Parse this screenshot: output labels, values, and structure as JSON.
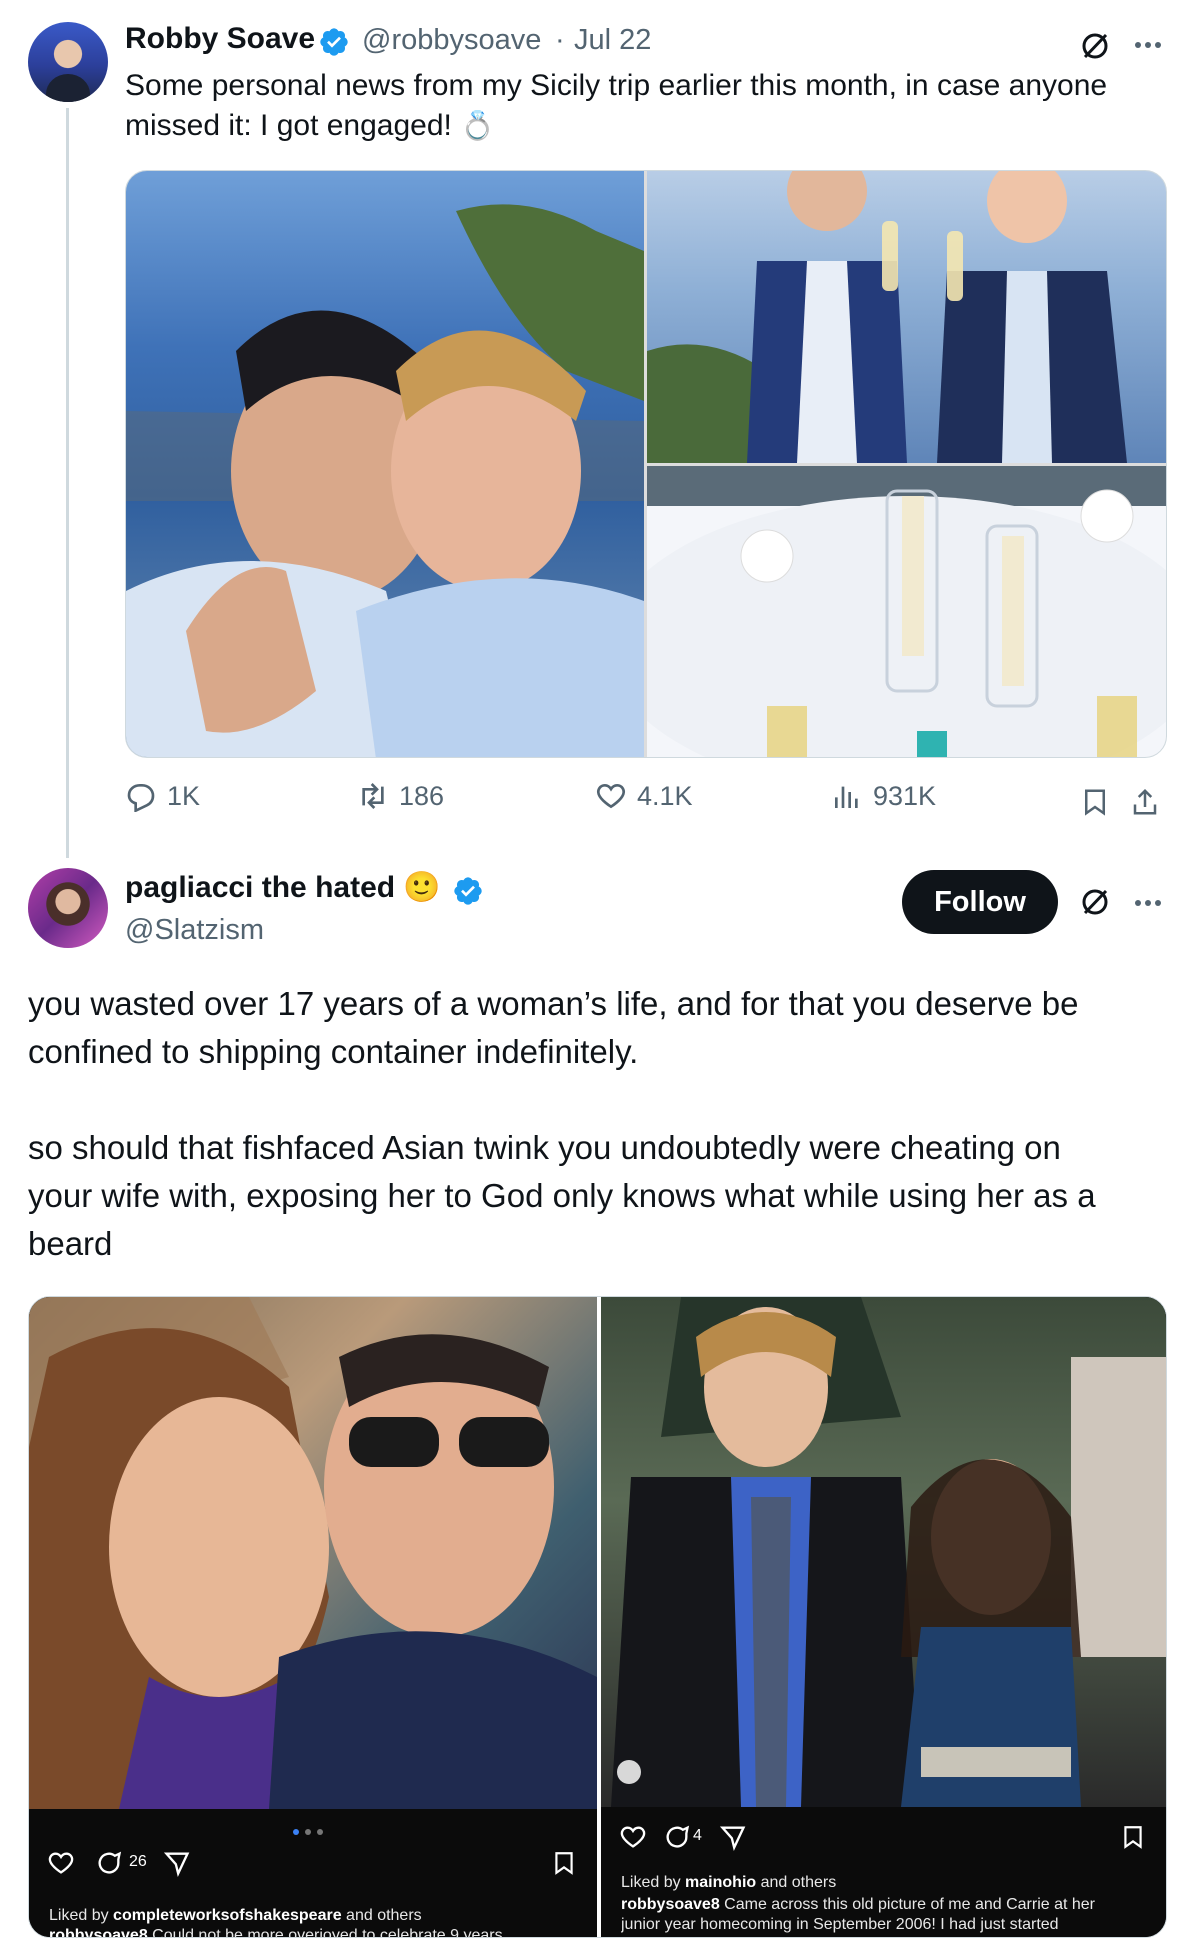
{
  "tweet": {
    "author_name": "Robby Soave",
    "handle": "@robbysoave",
    "separator": "·",
    "date": "Jul 22",
    "text_line1": "Some personal news from my Sicily trip earlier this month, in case anyone",
    "text_line2": "missed it: I got engaged!",
    "emoji": "💍",
    "stats": {
      "replies": "1K",
      "reposts": "186",
      "likes": "4.1K",
      "views": "931K"
    }
  },
  "reply": {
    "author_name": "pagliacci the hated",
    "emoji": "🙂",
    "handle": "@Slatzism",
    "follow_label": "Follow",
    "text": "you wasted over 17 years of a woman’s life, and for that you deserve be\nconfined to shipping container indefinitely.\n\nso should that fishfaced Asian twink you undoubtedly were cheating on\nyour wife with, exposing her to God only knows what while using her as a\nbeard",
    "screenshot_left": {
      "comment_count": "26",
      "liked_by_prefix": "Liked by",
      "liked_by_user": "completeworksofshakespeare",
      "liked_by_suffix": "and others",
      "caption_user": "robbysoave8",
      "caption_text": "Could not be more overjoyed to celebrate 9 years"
    },
    "screenshot_right": {
      "comment_count": "4",
      "liked_by_prefix": "Liked by",
      "liked_by_user": "mainohio",
      "liked_by_suffix": "and others",
      "caption_user": "robbysoave8",
      "caption_text": "Came across this old picture of me and Carrie at her",
      "caption_line2": "junior year homecoming in September 2006! I had just started"
    }
  },
  "colors": {
    "verified_blue": "#1d9bf0",
    "text_primary": "#0f1419",
    "text_secondary": "#536471",
    "follow_bg": "#0f1419"
  },
  "icons": [
    "grok-icon",
    "more-icon",
    "reply-icon",
    "repost-icon",
    "like-icon",
    "views-icon",
    "bookmark-icon",
    "share-icon",
    "verified-icon"
  ]
}
